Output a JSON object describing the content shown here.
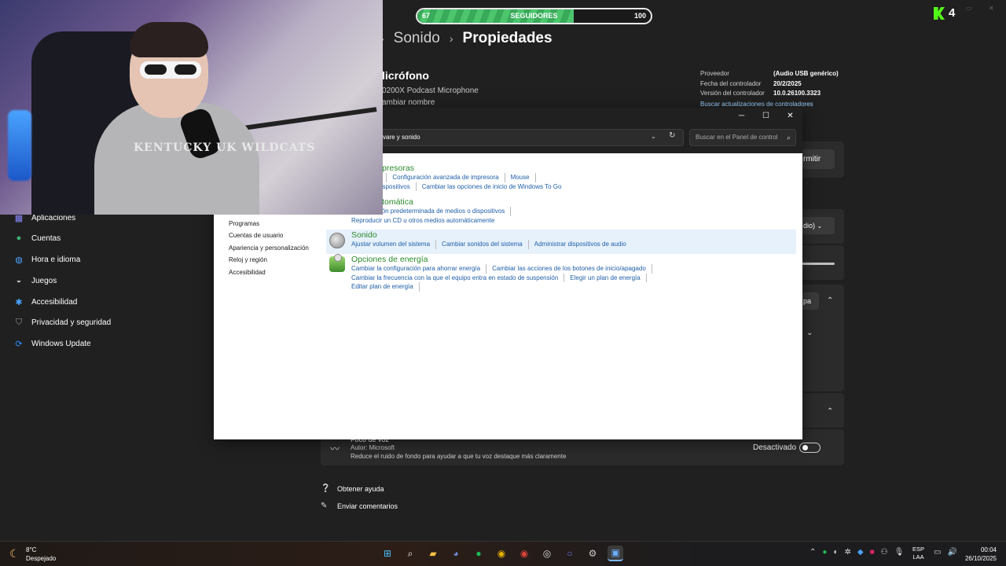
{
  "settings": {
    "breadcrumb": {
      "parent": "Sonido",
      "current": "Propiedades"
    },
    "device": {
      "title": "licrófono",
      "subtitle": "0200X Podcast Microphone",
      "rename": "ambiar nombre"
    },
    "properties": [
      {
        "key": "Proveedor",
        "value": "(Audio USB genérico)"
      },
      {
        "key": "Fecha del controlador",
        "value": "20/2/2025"
      },
      {
        "key": "Versión del controlador",
        "value": "10.0.26100.3323"
      }
    ],
    "driver_link": "Buscar actualizaciones de controladores",
    "permit_label": "rmitir",
    "dropdown_value": "dio)",
    "pa_label": "pa",
    "voice": {
      "title": "Foco de voz",
      "author": "Autor: Microsoft",
      "description": "Reduce el ruido de fondo para ayudar a que tu voz destaque más claramente",
      "state_label": "Desactivado"
    },
    "help_links": [
      "Obtener ayuda",
      "Enviar comentarios"
    ],
    "nav": [
      {
        "label": "Aplicaciones",
        "icon": "apps-icon",
        "color": "#8a8aff"
      },
      {
        "label": "Cuentas",
        "icon": "accounts-icon",
        "color": "#3cb371"
      },
      {
        "label": "Hora e idioma",
        "icon": "globe-icon",
        "color": "#4aa3ff"
      },
      {
        "label": "Juegos",
        "icon": "gamepad-icon",
        "color": "#bbbbbb"
      },
      {
        "label": "Accesibilidad",
        "icon": "accessibility-icon",
        "color": "#4aa3ff"
      },
      {
        "label": "Privacidad y seguridad",
        "icon": "shield-icon",
        "color": "#9a9a9a"
      },
      {
        "label": "Windows Update",
        "icon": "update-icon",
        "color": "#2b8aff"
      }
    ]
  },
  "control_panel": {
    "address": "vare y sonido",
    "search_placeholder": "Buscar en el Panel de control",
    "sidebar": [
      "Programas",
      "Cuentas de usuario",
      "Apariencia y personalización",
      "Reloj y región",
      "Accesibilidad"
    ],
    "categories": [
      {
        "title": "vos e impresoras",
        "rows": [
          [
            "dispositivo",
            "Configuración avanzada de impresora",
            "Mouse"
          ],
          [
            "zador de dispositivos",
            "Cambiar las opciones de inicio de Windows To Go"
          ]
        ]
      },
      {
        "title": "cción automática",
        "rows": [
          [
            "configuración predeterminada de medios o dispositivos"
          ],
          [
            "Reproducir un CD u otros medios automáticamente"
          ]
        ]
      },
      {
        "title": "Sonido",
        "rows": [
          [
            "Ajustar volumen del sistema",
            "Cambiar sonidos del sistema",
            "Administrar dispositivos de audio"
          ]
        ]
      },
      {
        "title": "Opciones de energía",
        "rows": [
          [
            "Cambiar la configuración para ahorrar energía",
            "Cambiar las acciones de los botones de inicio/apagado"
          ],
          [
            "Cambiar la frecuencia con la que el equipo entra en estado de suspensión",
            "Elegir un plan de energía"
          ],
          [
            "Editar plan de energía"
          ]
        ]
      }
    ]
  },
  "overlay": {
    "followers": {
      "current": "67",
      "label": "SEGUIDORES",
      "goal": "100",
      "progress": 0.67
    },
    "kick_count": "4",
    "webcam_text": "KENTUCKY UK WILDCATS"
  },
  "taskbar": {
    "weather": {
      "temp": "8°C",
      "desc": "Despejado"
    },
    "apps": [
      {
        "name": "start-icon",
        "glyph": "⊞",
        "color": "#4cc2ff"
      },
      {
        "name": "search-icon",
        "glyph": "⌕",
        "color": "#ffffff"
      },
      {
        "name": "file-explorer-icon",
        "glyph": "▰",
        "color": "#f5c242"
      },
      {
        "name": "discord-icon",
        "glyph": "◕",
        "color": "#7289da"
      },
      {
        "name": "spotify-icon",
        "glyph": "●",
        "color": "#1db954"
      },
      {
        "name": "chrome-icon",
        "glyph": "◉",
        "color": "#e6b400"
      },
      {
        "name": "chrome-profile-icon",
        "glyph": "◉",
        "color": "#db4437"
      },
      {
        "name": "obs-icon",
        "glyph": "◎",
        "color": "#dddddd"
      },
      {
        "name": "cortana-icon",
        "glyph": "○",
        "color": "#6c7cff"
      },
      {
        "name": "settings-icon",
        "glyph": "⚙",
        "color": "#cccccc"
      },
      {
        "name": "control-panel-icon",
        "glyph": "▣",
        "color": "#6bb0ff"
      }
    ],
    "lang": "ESP",
    "region": "LAA",
    "time": "00:04",
    "date": "26/10/2025"
  }
}
